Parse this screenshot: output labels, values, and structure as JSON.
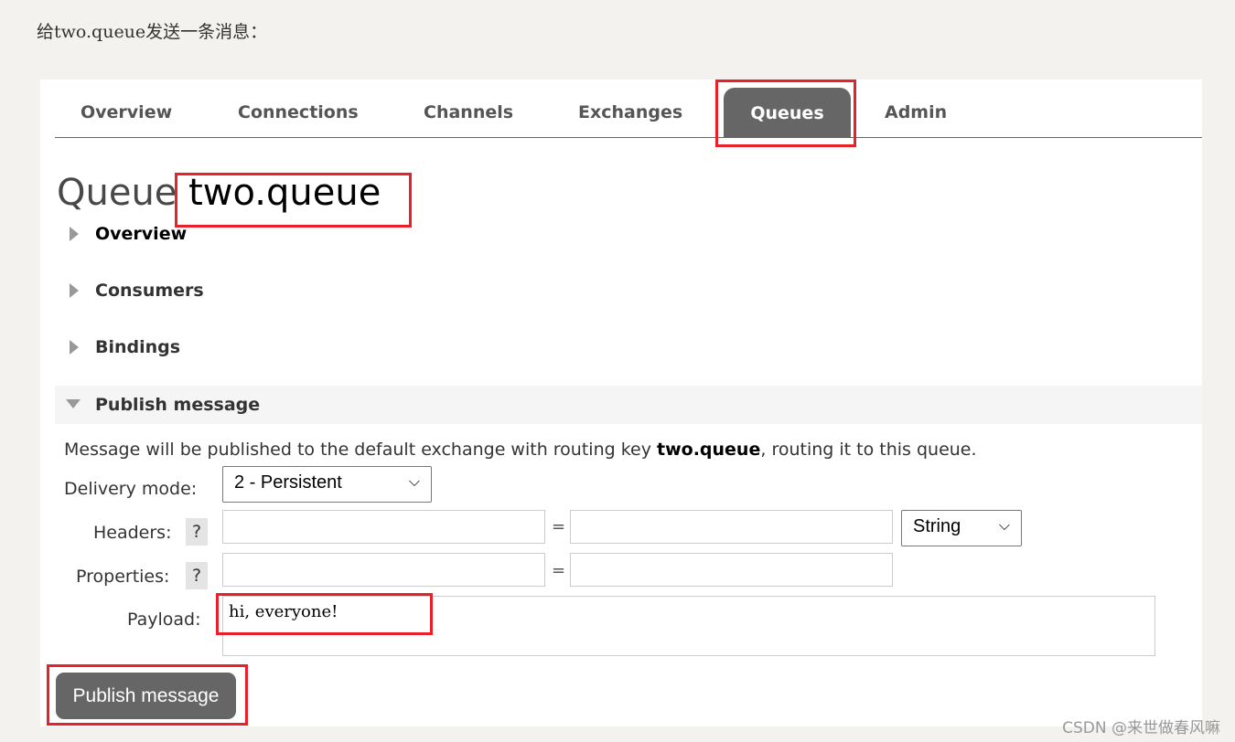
{
  "intro": "给two.queue发送一条消息：",
  "nav": {
    "tabs": [
      "Overview",
      "Connections",
      "Channels",
      "Exchanges",
      "Queues",
      "Admin"
    ],
    "active": "Queues"
  },
  "page": {
    "title_prefix": "Queue",
    "queue_name": "two.queue"
  },
  "sections": {
    "overview": "Overview",
    "consumers": "Consumers",
    "bindings": "Bindings",
    "publish": "Publish message"
  },
  "publish": {
    "info_pre": "Message will be published to the default exchange with routing key ",
    "info_key": "two.queue",
    "info_post": ", routing it to this queue.",
    "delivery_label": "Delivery mode:",
    "delivery_value": "2 - Persistent",
    "headers_label": "Headers:",
    "properties_label": "Properties:",
    "help": "?",
    "eq": "=",
    "header_type": "String",
    "payload_label": "Payload:",
    "payload": "hi, everyone!",
    "button": "Publish message"
  },
  "watermark": "CSDN @来世做春风嘛",
  "colors": {
    "highlight": "#e8202a",
    "active_tab": "#666666"
  }
}
